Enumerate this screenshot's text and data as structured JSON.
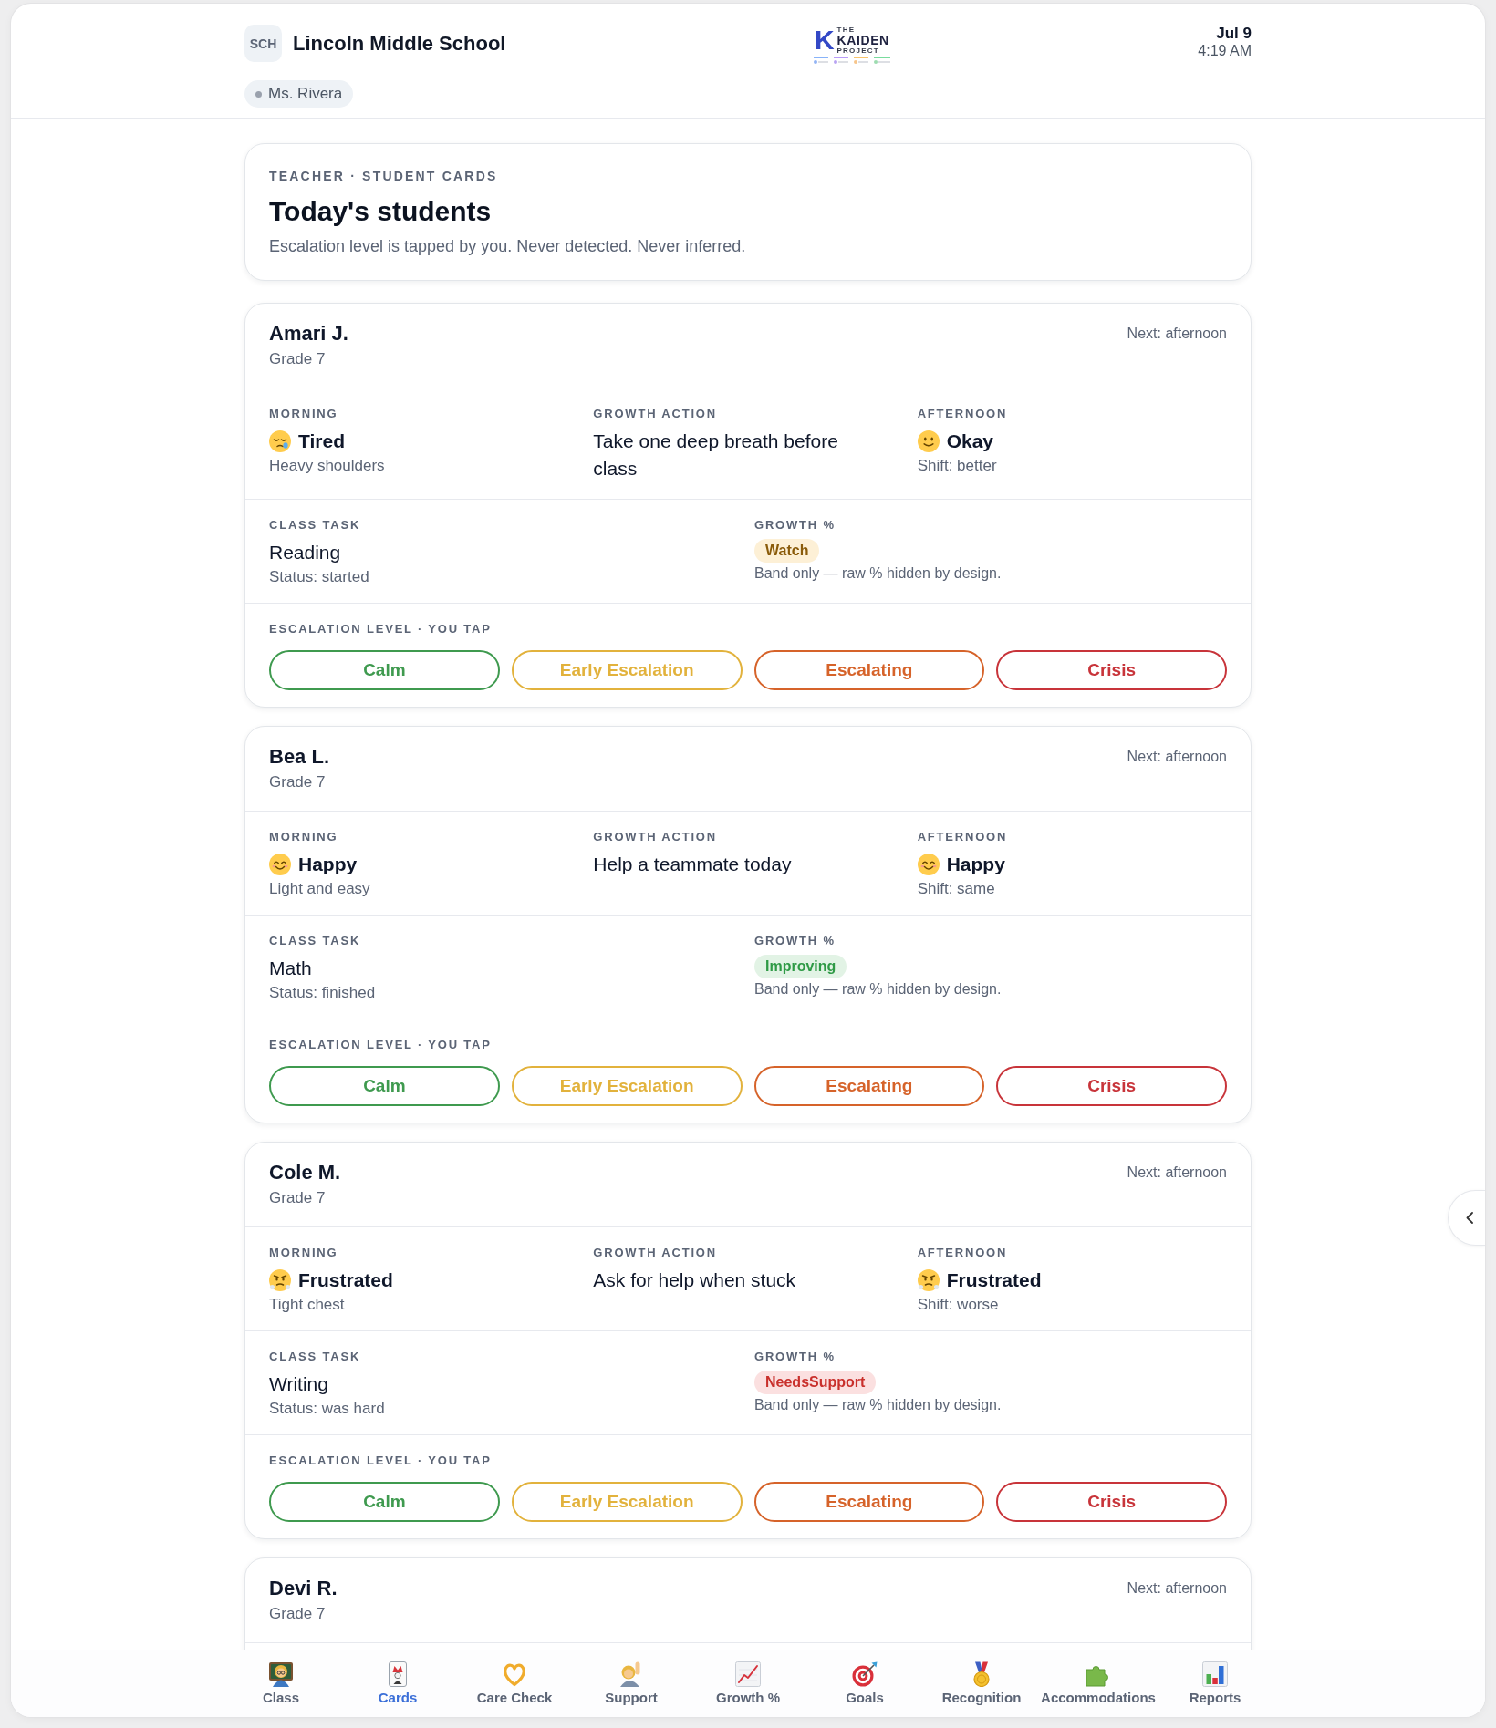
{
  "header": {
    "badge": "SCH",
    "school": "Lincoln Middle School",
    "teacher": "Ms. Rivera",
    "logo": {
      "mark": "K",
      "top": "THE",
      "name": "KAIDEN",
      "bottom": "PROJECT"
    },
    "date": "Jul 9",
    "time": "4:19 AM"
  },
  "intro": {
    "eyebrow": "TEACHER · STUDENT CARDS",
    "title": "Today's students",
    "subtitle": "Escalation level is tapped by you. Never detected. Never inferred."
  },
  "students": [
    {
      "name": "Amari J.",
      "grade": "Grade 7",
      "next": "Next: afternoon",
      "morning": {
        "label": "MORNING",
        "kind": "sleepy",
        "mood": "Tired",
        "note": "Heavy shoulders"
      },
      "growth_action": {
        "label": "GROWTH ACTION",
        "text": "Take one deep breath before class"
      },
      "afternoon": {
        "label": "AFTERNOON",
        "kind": "slight_smile",
        "mood": "Okay",
        "note": "Shift: better"
      },
      "class_task": {
        "label": "CLASS TASK",
        "task": "Reading",
        "status": "Status: started"
      },
      "growth": {
        "label": "GROWTH %",
        "kind": "watch",
        "band": "Watch",
        "note": "Band only — raw % hidden by design."
      },
      "escalation": {
        "label": "ESCALATION LEVEL · YOU TAP",
        "options": [
          {
            "label": "Calm",
            "kind": "calm",
            "selected": false
          },
          {
            "label": "Early Escalation",
            "kind": "early",
            "selected": false
          },
          {
            "label": "Escalating",
            "kind": "escalating",
            "selected": false
          },
          {
            "label": "Crisis",
            "kind": "crisis",
            "selected": false
          }
        ]
      }
    },
    {
      "name": "Bea L.",
      "grade": "Grade 7",
      "next": "Next: afternoon",
      "morning": {
        "label": "MORNING",
        "kind": "smile",
        "mood": "Happy",
        "note": "Light and easy"
      },
      "growth_action": {
        "label": "GROWTH ACTION",
        "text": "Help a teammate today"
      },
      "afternoon": {
        "label": "AFTERNOON",
        "kind": "smile",
        "mood": "Happy",
        "note": "Shift: same"
      },
      "class_task": {
        "label": "CLASS TASK",
        "task": "Math",
        "status": "Status: finished"
      },
      "growth": {
        "label": "GROWTH %",
        "kind": "improving",
        "band": "Improving",
        "note": "Band only — raw % hidden by design."
      },
      "escalation": {
        "label": "ESCALATION LEVEL · YOU TAP",
        "options": [
          {
            "label": "Calm",
            "kind": "calm",
            "selected": false
          },
          {
            "label": "Early Escalation",
            "kind": "early",
            "selected": false
          },
          {
            "label": "Escalating",
            "kind": "escalating",
            "selected": false
          },
          {
            "label": "Crisis",
            "kind": "crisis",
            "selected": false
          }
        ]
      }
    },
    {
      "name": "Cole M.",
      "grade": "Grade 7",
      "next": "Next: afternoon",
      "morning": {
        "label": "MORNING",
        "kind": "huff",
        "mood": "Frustrated",
        "note": "Tight chest"
      },
      "growth_action": {
        "label": "GROWTH ACTION",
        "text": "Ask for help when stuck"
      },
      "afternoon": {
        "label": "AFTERNOON",
        "kind": "huff",
        "mood": "Frustrated",
        "note": "Shift: worse"
      },
      "class_task": {
        "label": "CLASS TASK",
        "task": "Writing",
        "status": "Status: was hard"
      },
      "growth": {
        "label": "GROWTH %",
        "kind": "needs_support",
        "band": "NeedsSupport",
        "note": "Band only — raw % hidden by design."
      },
      "escalation": {
        "label": "ESCALATION LEVEL · YOU TAP",
        "options": [
          {
            "label": "Calm",
            "kind": "calm",
            "selected": false
          },
          {
            "label": "Early Escalation",
            "kind": "early",
            "selected": false
          },
          {
            "label": "Escalating",
            "kind": "escalating",
            "selected": false
          },
          {
            "label": "Crisis",
            "kind": "crisis",
            "selected": false
          }
        ]
      }
    },
    {
      "name": "Devi R.",
      "grade": "Grade 7",
      "next": "Next: afternoon"
    }
  ],
  "nav": [
    {
      "label": "Class",
      "selected": false
    },
    {
      "label": "Cards",
      "selected": true
    },
    {
      "label": "Care Check",
      "selected": false
    },
    {
      "label": "Support",
      "selected": false
    },
    {
      "label": "Growth %",
      "selected": false
    },
    {
      "label": "Goals",
      "selected": false
    },
    {
      "label": "Recognition",
      "selected": false
    },
    {
      "label": "Accommodations",
      "selected": false
    },
    {
      "label": "Reports",
      "selected": false
    }
  ]
}
